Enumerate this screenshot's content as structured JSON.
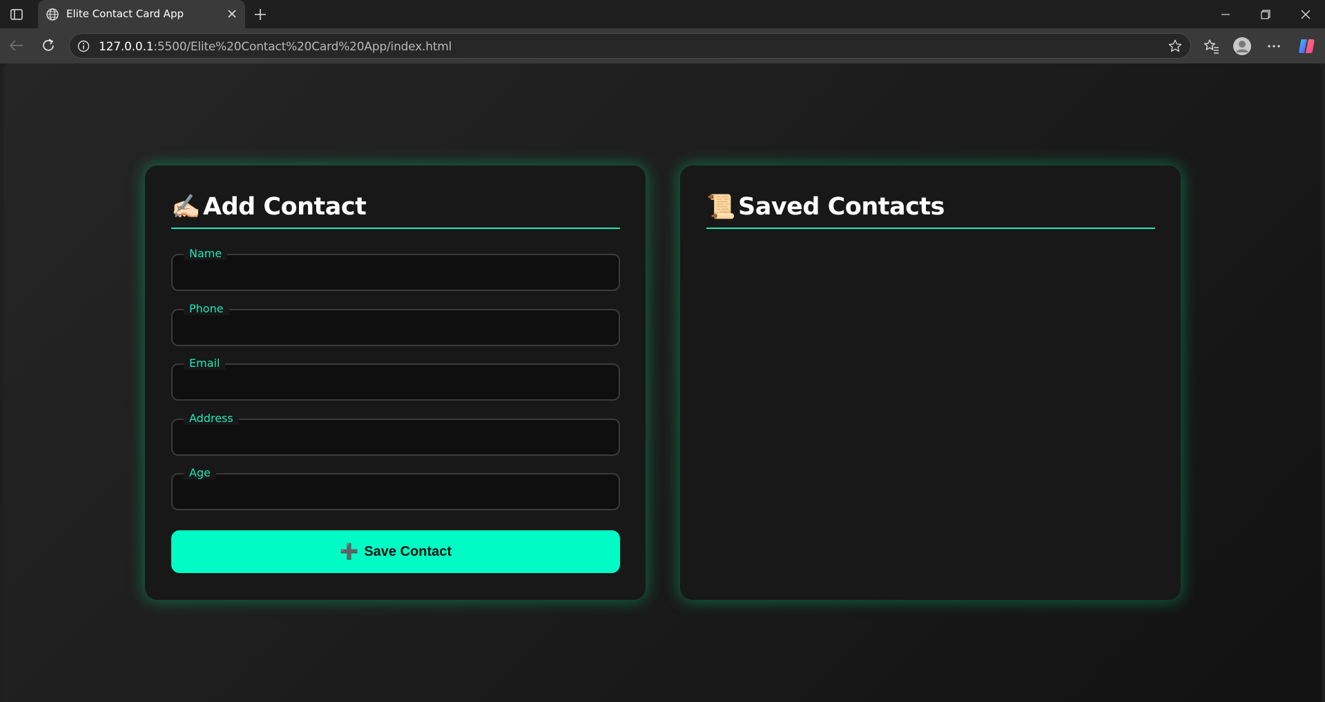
{
  "browser": {
    "tab_title": "Elite Contact Card App",
    "url_host": "127.0.0.1",
    "url_rest": ":5500/Elite%20Contact%20Card%20App/index.html"
  },
  "add_contact": {
    "emoji": "✍🏻",
    "title": "Add Contact",
    "fields": [
      {
        "legend": "Name",
        "value": ""
      },
      {
        "legend": "Phone",
        "value": ""
      },
      {
        "legend": "Email",
        "value": ""
      },
      {
        "legend": "Address",
        "value": ""
      },
      {
        "legend": "Age",
        "value": ""
      }
    ],
    "save_icon": "➕",
    "save_label": "Save Contact"
  },
  "saved_contacts": {
    "emoji": "📜",
    "title": "Saved Contacts",
    "items": []
  },
  "colors": {
    "accent": "#1de9b6",
    "button": "#00fcc4",
    "card_bg": "#181818",
    "glow": "#00e68c"
  }
}
